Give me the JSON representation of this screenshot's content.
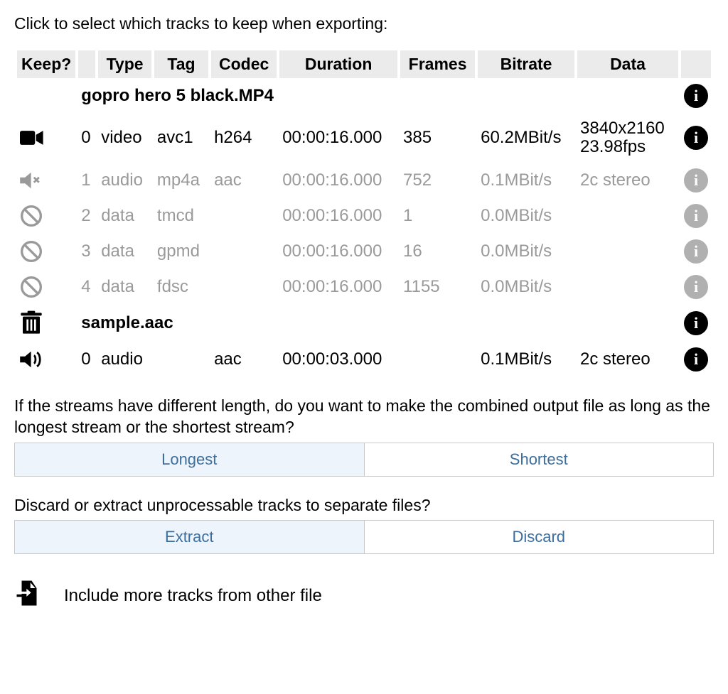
{
  "instruction": "Click to select which tracks to keep when exporting:",
  "columns": {
    "keep": "Keep?",
    "type": "Type",
    "tag": "Tag",
    "codec": "Codec",
    "duration": "Duration",
    "frames": "Frames",
    "bitrate": "Bitrate",
    "data": "Data"
  },
  "files": [
    {
      "name": "gopro hero 5 black.MP4",
      "tracks": [
        {
          "icon": "video",
          "muted": false,
          "index": "0",
          "type": "video",
          "tag": "avc1",
          "codec": "h264",
          "duration": "00:00:16.000",
          "frames": "385",
          "bitrate": "60.2MBit/s",
          "data_line1": "3840x2160",
          "data_line2": "23.98fps"
        },
        {
          "icon": "audio-muted",
          "muted": true,
          "index": "1",
          "type": "audio",
          "tag": "mp4a",
          "codec": "aac",
          "duration": "00:00:16.000",
          "frames": "752",
          "bitrate": "0.1MBit/s",
          "data_line1": "2c stereo",
          "data_line2": ""
        },
        {
          "icon": "ban",
          "muted": true,
          "index": "2",
          "type": "data",
          "tag": "tmcd",
          "codec": "",
          "duration": "00:00:16.000",
          "frames": "1",
          "bitrate": "0.0MBit/s",
          "data_line1": "",
          "data_line2": ""
        },
        {
          "icon": "ban",
          "muted": true,
          "index": "3",
          "type": "data",
          "tag": "gpmd",
          "codec": "",
          "duration": "00:00:16.000",
          "frames": "16",
          "bitrate": "0.0MBit/s",
          "data_line1": "",
          "data_line2": ""
        },
        {
          "icon": "ban",
          "muted": true,
          "index": "4",
          "type": "data",
          "tag": "fdsc",
          "codec": "",
          "duration": "00:00:16.000",
          "frames": "1155",
          "bitrate": "0.0MBit/s",
          "data_line1": "",
          "data_line2": ""
        }
      ]
    },
    {
      "name": "sample.aac",
      "file_icon": "trash",
      "tracks": [
        {
          "icon": "audio",
          "muted": false,
          "index": "0",
          "type": "audio",
          "tag": "",
          "codec": "aac",
          "duration": "00:00:03.000",
          "frames": "",
          "bitrate": "0.1MBit/s",
          "data_line1": "2c stereo",
          "data_line2": ""
        }
      ]
    }
  ],
  "length_question": {
    "text": "If the streams have different length, do you want to make the combined output file as long as the longest stream or the shortest stream?",
    "option_longest": "Longest",
    "option_shortest": "Shortest",
    "selected": "Longest"
  },
  "discard_question": {
    "text": "Discard or extract unprocessable tracks to separate files?",
    "option_extract": "Extract",
    "option_discard": "Discard",
    "selected": "Extract"
  },
  "include_more": "Include more tracks from other file"
}
